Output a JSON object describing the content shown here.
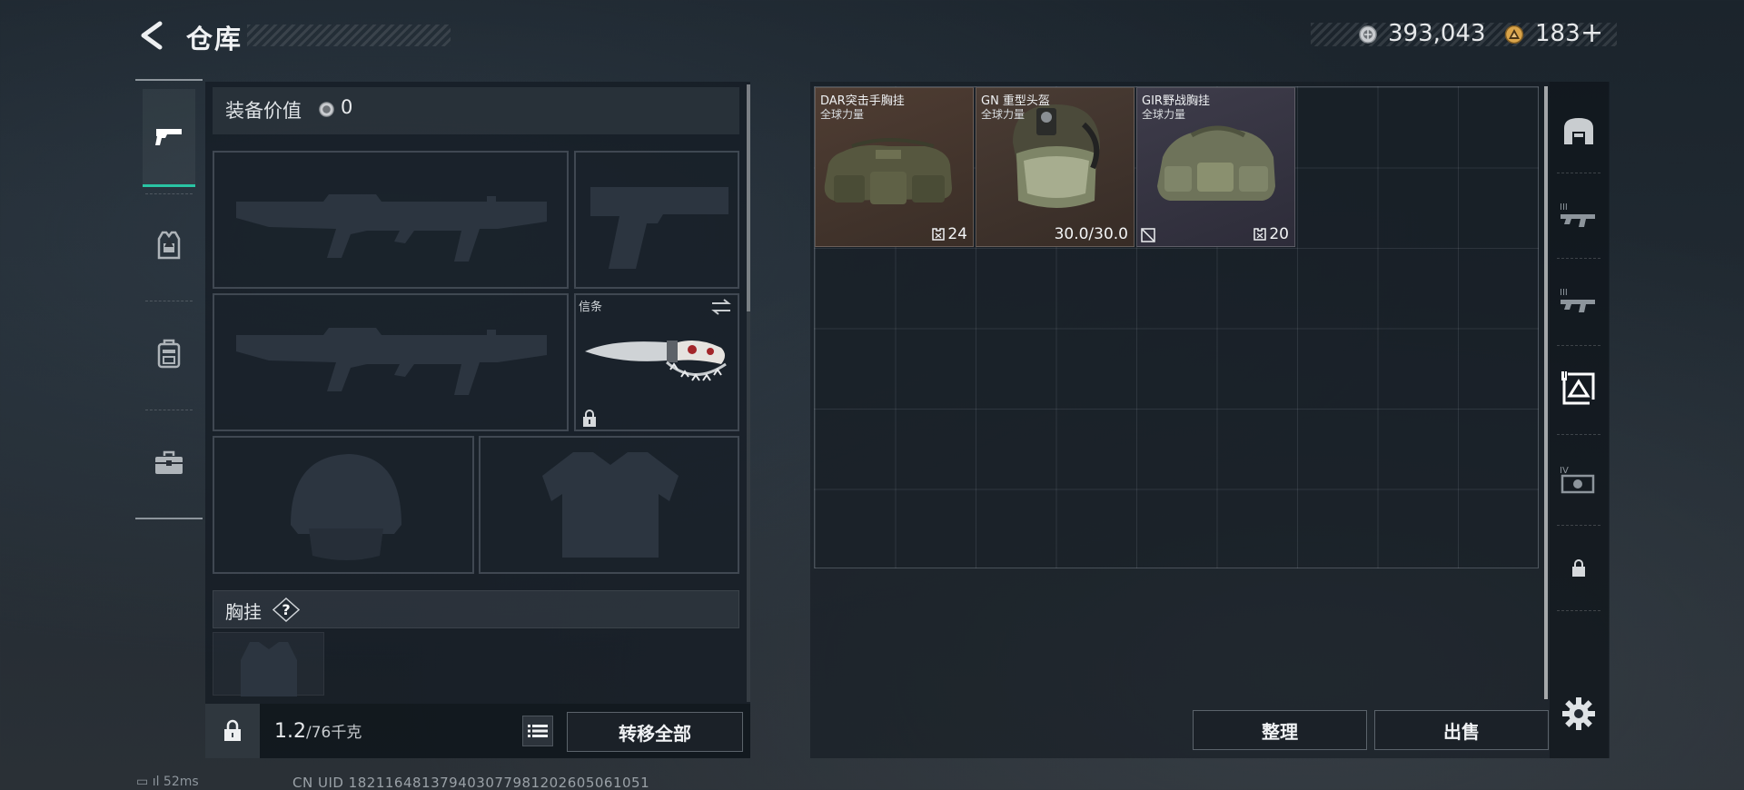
{
  "header": {
    "title": "仓库",
    "currency1": {
      "icon": "silver-coin-icon",
      "value": "393,043"
    },
    "currency2": {
      "icon": "gold-coin-icon",
      "value": "183",
      "add_label": "+"
    }
  },
  "left_tabs": [
    {
      "name": "weapon",
      "icon": "pistol-icon",
      "active": true
    },
    {
      "name": "armor",
      "icon": "armor-vest-icon",
      "active": false
    },
    {
      "name": "backpack",
      "icon": "backpack-icon",
      "active": false
    },
    {
      "name": "toolbox",
      "icon": "toolbox-icon",
      "active": false
    }
  ],
  "loadout": {
    "equip_value_label": "装备价值",
    "equip_value": "0",
    "slots": [
      {
        "name": "primary-weapon-1",
        "placeholder": "rifle-silhouette"
      },
      {
        "name": "pistol",
        "placeholder": "pistol-silhouette"
      },
      {
        "name": "primary-weapon-2",
        "placeholder": "rifle-silhouette"
      },
      {
        "name": "melee",
        "label": "信条",
        "item": "knife",
        "locked": true
      },
      {
        "name": "helmet",
        "placeholder": "helmet-silhouette"
      },
      {
        "name": "body-armor",
        "placeholder": "vest-silhouette"
      }
    ],
    "chest_rig_label": "胸挂",
    "help_label": "?"
  },
  "footer": {
    "weight_current": "1.2",
    "weight_max": "/76千克",
    "transfer_all": "转移全部",
    "sort": "整理",
    "sell": "出售"
  },
  "stash": {
    "columns": 9,
    "rows": 6,
    "items": [
      {
        "name": "DAR突击手胸挂",
        "sub": "全球力量",
        "value": "24",
        "value_icon": "capacity-icon",
        "image": "chest-rig"
      },
      {
        "name": "GN 重型头盔",
        "sub": "全球力量",
        "value": "30.0/30.0",
        "value_icon": "",
        "image": "helmet",
        "corner_icon": "no-repair-icon"
      },
      {
        "name": "GIR野战胸挂",
        "sub": "全球力量",
        "value": "20",
        "value_icon": "capacity-icon",
        "image": "chest-rig"
      }
    ]
  },
  "right_tabs": [
    {
      "name": "stash-tab-main",
      "icon": "stash-arch-icon"
    },
    {
      "name": "stash-tab-iii-1",
      "icon": "rifle-iii-icon"
    },
    {
      "name": "stash-tab-iii-2",
      "icon": "rifle-iii-icon"
    },
    {
      "name": "stash-tab-selected",
      "icon": "frame-triangle-icon",
      "active": true
    },
    {
      "name": "stash-tab-iv",
      "icon": "screen-iv-icon"
    },
    {
      "name": "stash-tab-locked",
      "icon": "lock-icon"
    }
  ],
  "status": {
    "ping": "52ms",
    "uid": "CN UID 18211648137940307798120260506105​1"
  }
}
